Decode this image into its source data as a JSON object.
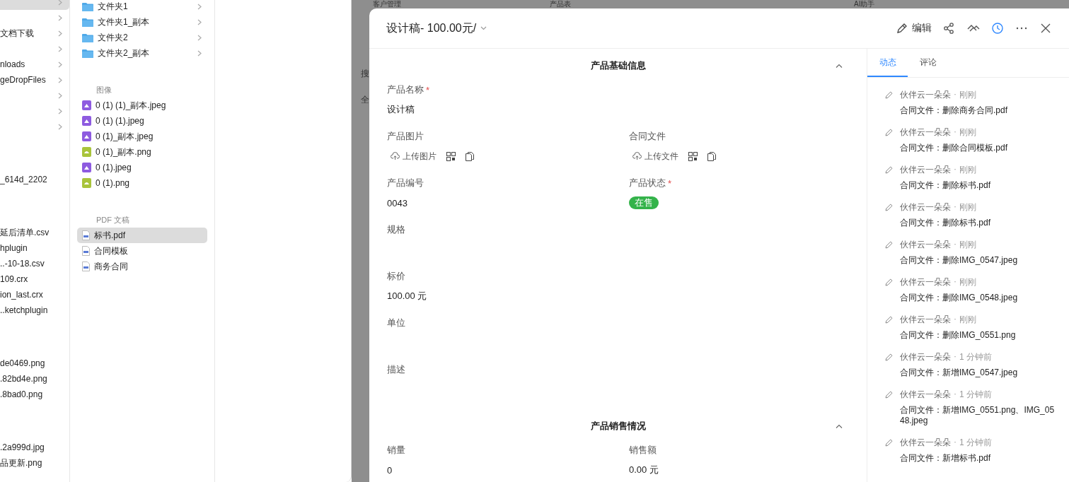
{
  "finder": {
    "column_1": {
      "groups": [
        [
          {
            "selected": true,
            "folder": true
          },
          {
            "selected": false,
            "folder": true
          },
          {
            "text": "文档下载",
            "selected": false,
            "folder": true
          },
          {
            "selected": false,
            "folder": true
          },
          {
            "text": "nloads",
            "selected": false,
            "folder": true
          },
          {
            "text": "geDropFiles",
            "selected": false,
            "folder": true
          },
          {
            "selected": false,
            "folder": true
          },
          {
            "selected": false,
            "folder": true
          },
          {
            "selected": false,
            "folder": true
          }
        ],
        [
          {
            "text": "_614d_2202",
            "selected": false,
            "folder": false
          }
        ],
        [
          {
            "text": "延后清单.csv",
            "selected": false,
            "folder": false
          },
          {
            "text": "hplugin",
            "selected": false,
            "folder": false
          },
          {
            "text": "..-10-18.csv",
            "selected": false,
            "folder": false
          },
          {
            "text": "109.crx",
            "selected": false,
            "folder": false
          },
          {
            "text": "ion_last.crx",
            "selected": false,
            "folder": false
          },
          {
            "text": "..ketchplugin",
            "selected": false,
            "folder": false
          }
        ],
        [
          {
            "text": "de0469.png",
            "selected": false,
            "folder": false
          },
          {
            "text": ".82bd4e.png",
            "selected": false,
            "folder": false
          },
          {
            "text": ".8bad0.png",
            "selected": false,
            "folder": false
          }
        ],
        [
          {
            "text": ".2a999d.jpg",
            "selected": false,
            "folder": false
          },
          {
            "text": "品更新.png",
            "selected": false,
            "folder": false
          }
        ]
      ]
    },
    "column_2": {
      "sections": [
        {
          "items": [
            {
              "name": "文件夹1",
              "kind": "folder",
              "selected": false
            },
            {
              "name": "文件夹1_副本",
              "kind": "folder",
              "selected": false
            },
            {
              "name": "文件夹2",
              "kind": "folder",
              "selected": false
            },
            {
              "name": "文件夹2_副本",
              "kind": "folder",
              "selected": false
            }
          ]
        },
        {
          "title": "图像",
          "items": [
            {
              "name": "0 (1) (1)_副本.jpeg",
              "kind": "jpeg",
              "selected": false
            },
            {
              "name": "0 (1) (1).jpeg",
              "kind": "jpeg",
              "selected": false
            },
            {
              "name": "0 (1)_副本.jpeg",
              "kind": "jpeg",
              "selected": false
            },
            {
              "name": "0 (1)_副本.png",
              "kind": "png",
              "selected": false
            },
            {
              "name": "0 (1).jpeg",
              "kind": "jpeg",
              "selected": false
            },
            {
              "name": "0 (1).png",
              "kind": "png",
              "selected": false
            }
          ]
        },
        {
          "title": "PDF 文稿",
          "items": [
            {
              "name": "标书.pdf",
              "kind": "pdf",
              "selected": true
            },
            {
              "name": "合同模板",
              "kind": "pdf",
              "selected": false
            },
            {
              "name": "商务合同",
              "kind": "pdf",
              "selected": false
            }
          ]
        }
      ]
    }
  },
  "background_app": {
    "workspace": "客户管理",
    "table": "产品表",
    "assistant": "AI助手",
    "sidebar_chars": [
      "搜",
      "全"
    ]
  },
  "drawer": {
    "title": "设计稿- 100.00元/",
    "edit_label": "编辑",
    "actions": [
      {
        "kind": "share",
        "selected": false
      },
      {
        "kind": "collaborate",
        "selected": false
      },
      {
        "kind": "history",
        "selected": true
      },
      {
        "kind": "more",
        "selected": false
      },
      {
        "kind": "close",
        "selected": false
      }
    ],
    "sections": [
      {
        "title": "产品基础信息",
        "expanded": true,
        "rows": [
          [
            {
              "label": "产品名称",
              "required_mark": "*",
              "kind": "text",
              "value": "设计稿"
            }
          ],
          [
            {
              "label": "产品图片",
              "kind": "upload",
              "button": "上传图片"
            },
            {
              "label": "合同文件",
              "kind": "upload",
              "button": "上传文件"
            }
          ],
          [
            {
              "label": "产品编号",
              "kind": "text",
              "value": "0043"
            },
            {
              "label": "产品状态",
              "required_mark": "*",
              "kind": "tag",
              "value": "在售"
            }
          ],
          [
            {
              "label": "规格",
              "kind": "text"
            }
          ],
          [
            {
              "label": "标价",
              "kind": "text",
              "value": "100.00 元"
            }
          ],
          [
            {
              "label": "单位",
              "kind": "text"
            }
          ],
          [
            {
              "label": "描述",
              "kind": "text"
            }
          ]
        ]
      },
      {
        "title": "产品销售情况",
        "expanded": true,
        "rows": [
          [
            {
              "label": "销量",
              "kind": "text",
              "value": "0"
            },
            {
              "label": "销售额",
              "kind": "text",
              "value": "0.00 元"
            }
          ]
        ]
      }
    ],
    "activity": {
      "separator": "·",
      "tabs": [
        {
          "label": "动态",
          "selected": true
        },
        {
          "label": "评论",
          "selected": false
        }
      ],
      "entries": [
        {
          "user": "伙伴云一朵朵",
          "time": "刚刚",
          "text": "合同文件：删除商务合同.pdf"
        },
        {
          "user": "伙伴云一朵朵",
          "time": "刚刚",
          "text": "合同文件：删除合同模板.pdf"
        },
        {
          "user": "伙伴云一朵朵",
          "time": "刚刚",
          "text": "合同文件：删除标书.pdf"
        },
        {
          "user": "伙伴云一朵朵",
          "time": "刚刚",
          "text": "合同文件：删除标书.pdf"
        },
        {
          "user": "伙伴云一朵朵",
          "time": "刚刚",
          "text": "合同文件：删除IMG_0547.jpeg"
        },
        {
          "user": "伙伴云一朵朵",
          "time": "刚刚",
          "text": "合同文件：删除IMG_0548.jpeg"
        },
        {
          "user": "伙伴云一朵朵",
          "time": "刚刚",
          "text": "合同文件：删除IMG_0551.png"
        },
        {
          "user": "伙伴云一朵朵",
          "time": "1 分钟前",
          "text": "合同文件：新增IMG_0547.jpeg"
        },
        {
          "user": "伙伴云一朵朵",
          "time": "1 分钟前",
          "text": "合同文件：新增IMG_0551.png、IMG_0548.jpeg"
        },
        {
          "user": "伙伴云一朵朵",
          "time": "1 分钟前",
          "text": "合同文件：新增标书.pdf"
        }
      ]
    }
  }
}
